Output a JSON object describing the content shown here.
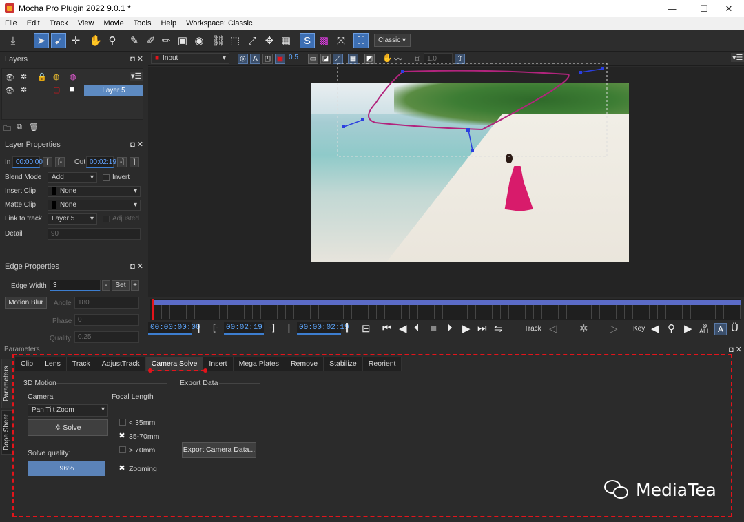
{
  "window": {
    "title": "Mocha Pro Plugin 2022 9.0.1 *",
    "controls": [
      "—",
      "☐",
      "✕"
    ]
  },
  "menu": [
    "File",
    "Edit",
    "Track",
    "View",
    "Movie",
    "Tools",
    "Help",
    "Workspace: Classic"
  ],
  "toolbar": {
    "workspace_value": "Classic"
  },
  "layers_panel": {
    "title": "Layers",
    "layer_name": "Layer 5"
  },
  "layer_properties": {
    "title": "Layer Properties",
    "in_label": "In",
    "in_value": "00:00:00",
    "out_label": "Out",
    "out_value": "00:02:19",
    "blend_label": "Blend Mode",
    "blend_value": "Add",
    "invert_label": "Invert",
    "insert_clip_label": "Insert Clip",
    "insert_clip_value": "None",
    "matte_clip_label": "Matte Clip",
    "matte_clip_value": "None",
    "link_label": "Link to track",
    "link_value": "Layer 5",
    "adjusted_label": "Adjusted",
    "detail_label": "Detail",
    "detail_value": "90"
  },
  "edge_properties": {
    "title": "Edge Properties",
    "edge_width_label": "Edge Width",
    "edge_width_value": "3",
    "set_label": "Set",
    "motion_blur_label": "Motion Blur",
    "angle_label": "Angle",
    "angle_value": "180",
    "phase_label": "Phase",
    "phase_value": "0",
    "quality_label": "Quality",
    "quality_value": "0.25"
  },
  "viewer": {
    "clip_value": "Input",
    "opacity_value": "0.5",
    "zoom_value": "1.0"
  },
  "transport": {
    "timecode_current": "00:00:00:00",
    "timecode_out": "00:02:19",
    "timecode_end": "00:00:02:19",
    "track_label": "Track",
    "key_label": "Key",
    "all_label": "ALL"
  },
  "params": {
    "header": "Parameters",
    "side_tabs": [
      "Parameters",
      "Dope Sheet"
    ],
    "tabs": [
      "Clip",
      "Lens",
      "Track",
      "AdjustTrack",
      "Camera Solve",
      "Insert",
      "Mega Plates",
      "Remove",
      "Stabilize",
      "Reorient"
    ],
    "motion_group": "3D Motion",
    "camera_label": "Camera",
    "camera_value": "Pan Tilt Zoom",
    "solve_label": "Solve",
    "solve_quality_label": "Solve quality:",
    "solve_quality_value": "96%",
    "focal_label": "Focal Length",
    "focal_options": [
      "< 35mm",
      "35-70mm",
      "> 70mm"
    ],
    "zooming_label": "Zooming",
    "export_group": "Export Data",
    "export_button": "Export Camera Data..."
  },
  "watermark": {
    "text": "MediaTea"
  },
  "colors": {
    "accent": "#3d7ed0",
    "highlight": "#e3141b",
    "selection": "#5d8ac1"
  }
}
